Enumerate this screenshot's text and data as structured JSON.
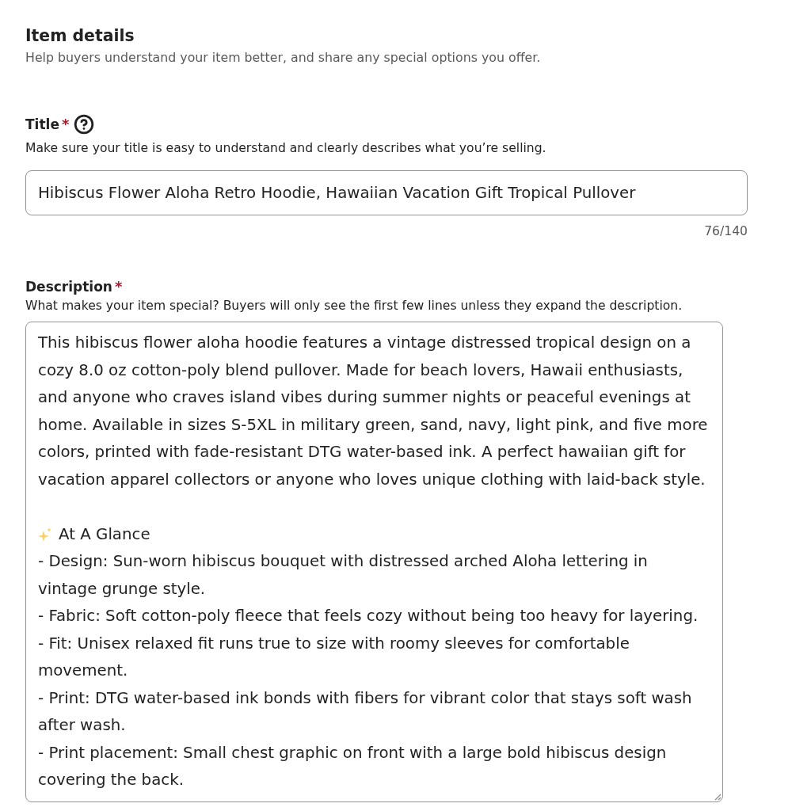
{
  "header": {
    "title": "Item details",
    "subtitle": "Help buyers understand your item better, and share any special options you offer."
  },
  "title_field": {
    "label": "Title",
    "required_mark": "*",
    "help": true,
    "hint": "Make sure your title is easy to understand and clearly describes what you’re selling.",
    "value": "Hibiscus Flower Aloha Retro Hoodie, Hawaiian Vacation Gift Tropical Pullover",
    "counter": "76/140"
  },
  "description_field": {
    "label": "Description",
    "required_mark": "*",
    "hint": "What makes your item special? Buyers will only see the first few lines unless they expand the description.",
    "blocks": [
      {
        "kind": "paragraph",
        "text": "This hibiscus flower aloha hoodie features a vintage distressed tropical design on a cozy 8.0 oz cotton-poly blend pullover. Made for beach lovers, Hawaii enthusiasts, and anyone who craves island vibes during summer nights or peaceful evenings at home. Available in sizes S-5XL in military green, sand, navy, light pink, and five more colors, printed with fade-resistant DTG water-based ink. A perfect hawaiian gift for vacation apparel collectors or anyone who loves unique clothing with laid-back style."
      },
      {
        "kind": "heading",
        "text": "At A Glance"
      },
      {
        "kind": "bullet",
        "text": "- Design: Sun-worn hibiscus bouquet with distressed arched Aloha lettering in vintage grunge style."
      },
      {
        "kind": "bullet",
        "text": "- Fabric: Soft cotton-poly fleece that feels cozy without being too heavy for layering."
      },
      {
        "kind": "bullet",
        "text": "- Fit: Unisex relaxed fit runs true to size with roomy sleeves for comfortable movement."
      },
      {
        "kind": "bullet",
        "text": "- Print: DTG water-based ink bonds with fibers for vibrant color that stays soft wash after wash."
      },
      {
        "kind": "bullet",
        "text": "- Print placement: Small chest graphic on front with a large bold hibiscus design covering the back."
      }
    ]
  }
}
